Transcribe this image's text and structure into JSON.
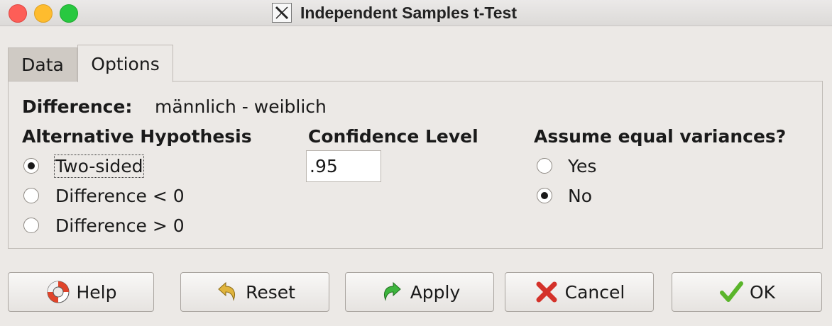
{
  "window": {
    "title": "Independent Samples t-Test",
    "app_icon": "x11-icon",
    "controls": [
      "close",
      "minimize",
      "zoom"
    ]
  },
  "tabs": [
    {
      "label": "Data",
      "selected": false
    },
    {
      "label": "Options",
      "selected": true
    }
  ],
  "difference": {
    "label": "Difference:",
    "value": "männlich - weiblich"
  },
  "alternative": {
    "heading": "Alternative Hypothesis",
    "options": [
      {
        "label": "Two-sided",
        "checked": true
      },
      {
        "label": "Difference < 0",
        "checked": false
      },
      {
        "label": "Difference > 0",
        "checked": false
      }
    ]
  },
  "confidence": {
    "heading": "Confidence Level",
    "value": ".95"
  },
  "equal_var": {
    "heading": "Assume equal variances?",
    "options": [
      {
        "label": "Yes",
        "checked": false
      },
      {
        "label": "No",
        "checked": true
      }
    ]
  },
  "buttons": {
    "help": {
      "label": "Help",
      "icon": "lifebuoy-icon"
    },
    "reset": {
      "label": "Reset",
      "icon": "undo-arrow-icon"
    },
    "apply": {
      "label": "Apply",
      "icon": "redo-arrow-icon"
    },
    "cancel": {
      "label": "Cancel",
      "icon": "red-x-icon"
    },
    "ok": {
      "label": "OK",
      "icon": "green-check-icon"
    }
  }
}
